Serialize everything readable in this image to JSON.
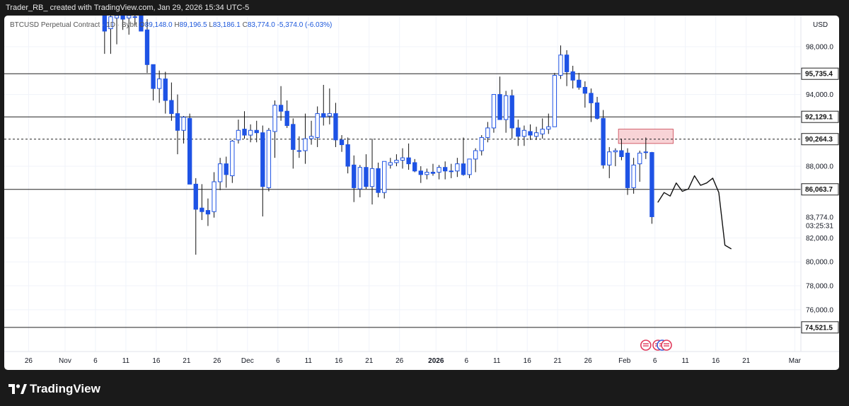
{
  "header": {
    "caption": "Trader_RB_ created with TradingView.com, Jan 29, 2026 15:34 UTC-5"
  },
  "symbol_bar": {
    "name": "BTCUSD Perpetual Contract",
    "interval": "1D",
    "exchange": "Bybit",
    "o_label": "O",
    "o_value": "89,148.0",
    "h_label": "H",
    "h_value": "89,196.5",
    "l_label": "L",
    "l_value": "83,186.1",
    "c_label": "C",
    "c_value": "83,774.0",
    "change": "-5,374.0 (-6.03%)"
  },
  "footer": {
    "brand": "TradingView"
  },
  "chart_data": {
    "type": "candlestick",
    "symbol": "BTCUSD Perpetual Contract",
    "interval": "1D",
    "exchange": "Bybit",
    "currency": "USD",
    "ylim": [
      72500,
      100600
    ],
    "y_ticks": [
      76000,
      78000,
      80000,
      82000,
      88000,
      94000,
      98000
    ],
    "y_tick_labels": [
      "76,000.0",
      "78,000.0",
      "80,000.0",
      "82,000.0",
      "88,000.0",
      "94,000.0",
      "98,000.0"
    ],
    "x_ticks": [
      {
        "label": "26",
        "date": "2025-10-26"
      },
      {
        "label": "Nov",
        "date": "2025-11-01"
      },
      {
        "label": "6",
        "date": "2025-11-06"
      },
      {
        "label": "11",
        "date": "2025-11-11"
      },
      {
        "label": "16",
        "date": "2025-11-16"
      },
      {
        "label": "21",
        "date": "2025-11-21"
      },
      {
        "label": "26",
        "date": "2025-11-26"
      },
      {
        "label": "Dec",
        "date": "2025-12-01"
      },
      {
        "label": "6",
        "date": "2025-12-06"
      },
      {
        "label": "11",
        "date": "2025-12-11"
      },
      {
        "label": "16",
        "date": "2025-12-16"
      },
      {
        "label": "21",
        "date": "2025-12-21"
      },
      {
        "label": "26",
        "date": "2025-12-26"
      },
      {
        "label": "2026",
        "date": "2026-01-01"
      },
      {
        "label": "6",
        "date": "2026-01-06"
      },
      {
        "label": "11",
        "date": "2026-01-11"
      },
      {
        "label": "16",
        "date": "2026-01-16"
      },
      {
        "label": "21",
        "date": "2026-01-21"
      },
      {
        "label": "26",
        "date": "2026-01-26"
      },
      {
        "label": "Feb",
        "date": "2026-02-01"
      },
      {
        "label": "6",
        "date": "2026-02-06"
      },
      {
        "label": "11",
        "date": "2026-02-11"
      },
      {
        "label": "16",
        "date": "2026-02-16"
      },
      {
        "label": "21",
        "date": "2026-02-21"
      },
      {
        "label": "Mar",
        "date": "2026-03-01"
      }
    ],
    "x_range": [
      "2025-10-22",
      "2026-03-02"
    ],
    "candles": [
      {
        "date": "2025-11-07",
        "o": 100900,
        "h": 101400,
        "l": 97400,
        "c": 99300
      },
      {
        "date": "2025-11-08",
        "o": 99500,
        "h": 101200,
        "l": 97400,
        "c": 100500
      },
      {
        "date": "2025-11-09",
        "o": 100400,
        "h": 101100,
        "l": 98200,
        "c": 100600
      },
      {
        "date": "2025-11-10",
        "o": 100600,
        "h": 101400,
        "l": 99400,
        "c": 100300
      },
      {
        "date": "2025-11-11",
        "o": 100400,
        "h": 100900,
        "l": 99000,
        "c": 100600
      },
      {
        "date": "2025-11-12",
        "o": 100500,
        "h": 101000,
        "l": 99800,
        "c": 100500
      },
      {
        "date": "2025-11-13",
        "o": 100600,
        "h": 101200,
        "l": 99600,
        "c": 99300
      },
      {
        "date": "2025-11-14",
        "o": 99400,
        "h": 100300,
        "l": 95800,
        "c": 96500
      },
      {
        "date": "2025-11-15",
        "o": 96500,
        "h": 96500,
        "l": 93500,
        "c": 94500
      },
      {
        "date": "2025-11-16",
        "o": 94500,
        "h": 96000,
        "l": 93300,
        "c": 95300
      },
      {
        "date": "2025-11-17",
        "o": 95300,
        "h": 95900,
        "l": 92400,
        "c": 93500
      },
      {
        "date": "2025-11-18",
        "o": 93500,
        "h": 95000,
        "l": 91800,
        "c": 92400
      },
      {
        "date": "2025-11-19",
        "o": 92400,
        "h": 94000,
        "l": 89000,
        "c": 91000
      },
      {
        "date": "2025-11-20",
        "o": 91000,
        "h": 92200,
        "l": 89900,
        "c": 92100
      },
      {
        "date": "2025-11-21",
        "o": 92000,
        "h": 92400,
        "l": 87600,
        "c": 86500
      },
      {
        "date": "2025-11-22",
        "o": 86500,
        "h": 87000,
        "l": 80600,
        "c": 84400
      },
      {
        "date": "2025-11-23",
        "o": 84500,
        "h": 86500,
        "l": 83500,
        "c": 84200
      },
      {
        "date": "2025-11-24",
        "o": 84300,
        "h": 85300,
        "l": 83000,
        "c": 84000
      },
      {
        "date": "2025-11-25",
        "o": 84200,
        "h": 87500,
        "l": 83700,
        "c": 86700
      },
      {
        "date": "2025-11-26",
        "o": 86700,
        "h": 88700,
        "l": 86000,
        "c": 88200
      },
      {
        "date": "2025-11-27",
        "o": 88200,
        "h": 88800,
        "l": 86200,
        "c": 87300
      },
      {
        "date": "2025-11-28",
        "o": 87200,
        "h": 90200,
        "l": 86600,
        "c": 90100
      },
      {
        "date": "2025-11-29",
        "o": 90200,
        "h": 91900,
        "l": 89900,
        "c": 91000
      },
      {
        "date": "2025-11-30",
        "o": 91100,
        "h": 92600,
        "l": 90300,
        "c": 90600
      },
      {
        "date": "2025-12-01",
        "o": 90600,
        "h": 91500,
        "l": 90000,
        "c": 91000
      },
      {
        "date": "2025-12-02",
        "o": 91000,
        "h": 91800,
        "l": 90000,
        "c": 90800
      },
      {
        "date": "2025-12-03",
        "o": 90800,
        "h": 91400,
        "l": 83800,
        "c": 86300
      },
      {
        "date": "2025-12-04",
        "o": 86200,
        "h": 91200,
        "l": 85900,
        "c": 91000
      },
      {
        "date": "2025-12-05",
        "o": 90900,
        "h": 93500,
        "l": 88700,
        "c": 93100
      },
      {
        "date": "2025-12-06",
        "o": 93100,
        "h": 94700,
        "l": 91800,
        "c": 92600
      },
      {
        "date": "2025-12-07",
        "o": 92600,
        "h": 93500,
        "l": 91200,
        "c": 91400
      },
      {
        "date": "2025-12-08",
        "o": 91500,
        "h": 92000,
        "l": 87800,
        "c": 89400
      },
      {
        "date": "2025-12-09",
        "o": 89300,
        "h": 90500,
        "l": 88700,
        "c": 89300
      },
      {
        "date": "2025-12-10",
        "o": 89300,
        "h": 92400,
        "l": 88200,
        "c": 90300
      },
      {
        "date": "2025-12-11",
        "o": 90300,
        "h": 91800,
        "l": 89800,
        "c": 90500
      },
      {
        "date": "2025-12-12",
        "o": 90400,
        "h": 93000,
        "l": 89600,
        "c": 92400
      },
      {
        "date": "2025-12-13",
        "o": 92400,
        "h": 94800,
        "l": 91400,
        "c": 92100
      },
      {
        "date": "2025-12-14",
        "o": 92200,
        "h": 94500,
        "l": 91500,
        "c": 92400
      },
      {
        "date": "2025-12-15",
        "o": 92400,
        "h": 93300,
        "l": 89600,
        "c": 90200
      },
      {
        "date": "2025-12-16",
        "o": 90200,
        "h": 90600,
        "l": 89200,
        "c": 89800
      },
      {
        "date": "2025-12-17",
        "o": 89800,
        "h": 90400,
        "l": 87400,
        "c": 88000
      },
      {
        "date": "2025-12-18",
        "o": 88100,
        "h": 88900,
        "l": 85000,
        "c": 86200
      },
      {
        "date": "2025-12-19",
        "o": 86100,
        "h": 88100,
        "l": 85400,
        "c": 87900
      },
      {
        "date": "2025-12-20",
        "o": 87900,
        "h": 89000,
        "l": 86100,
        "c": 86300
      },
      {
        "date": "2025-12-21",
        "o": 86300,
        "h": 90300,
        "l": 84800,
        "c": 87800
      },
      {
        "date": "2025-12-22",
        "o": 87800,
        "h": 88300,
        "l": 85400,
        "c": 85800
      },
      {
        "date": "2025-12-23",
        "o": 85800,
        "h": 88300,
        "l": 85300,
        "c": 88400
      },
      {
        "date": "2025-12-24",
        "o": 88100,
        "h": 88700,
        "l": 87800,
        "c": 88300
      },
      {
        "date": "2025-12-25",
        "o": 88300,
        "h": 89000,
        "l": 88000,
        "c": 88500
      },
      {
        "date": "2025-12-26",
        "o": 88500,
        "h": 89500,
        "l": 87800,
        "c": 88700
      },
      {
        "date": "2025-12-27",
        "o": 88700,
        "h": 89900,
        "l": 87700,
        "c": 88200
      },
      {
        "date": "2025-12-28",
        "o": 88300,
        "h": 88600,
        "l": 87500,
        "c": 87600
      },
      {
        "date": "2025-12-29",
        "o": 87600,
        "h": 88000,
        "l": 86600,
        "c": 87300
      },
      {
        "date": "2025-12-30",
        "o": 87300,
        "h": 87800,
        "l": 86900,
        "c": 87500
      },
      {
        "date": "2025-12-31",
        "o": 87500,
        "h": 88200,
        "l": 87200,
        "c": 87400
      },
      {
        "date": "2026-01-01",
        "o": 87500,
        "h": 88100,
        "l": 86900,
        "c": 87900
      },
      {
        "date": "2026-01-02",
        "o": 87900,
        "h": 88400,
        "l": 86900,
        "c": 87600
      },
      {
        "date": "2026-01-03",
        "o": 87600,
        "h": 88200,
        "l": 87000,
        "c": 87600
      },
      {
        "date": "2026-01-04",
        "o": 87600,
        "h": 88700,
        "l": 87100,
        "c": 88200
      },
      {
        "date": "2026-01-05",
        "o": 88200,
        "h": 90400,
        "l": 87200,
        "c": 87300
      },
      {
        "date": "2026-01-06",
        "o": 87300,
        "h": 88300,
        "l": 87000,
        "c": 88600
      },
      {
        "date": "2026-01-07",
        "o": 88600,
        "h": 89500,
        "l": 87500,
        "c": 89300
      },
      {
        "date": "2026-01-08",
        "o": 89300,
        "h": 90600,
        "l": 88900,
        "c": 90400
      },
      {
        "date": "2026-01-09",
        "o": 90400,
        "h": 91700,
        "l": 90000,
        "c": 91200
      },
      {
        "date": "2026-01-10",
        "o": 91200,
        "h": 93000,
        "l": 90800,
        "c": 94000
      },
      {
        "date": "2026-01-11",
        "o": 94000,
        "h": 95500,
        "l": 93400,
        "c": 91900
      },
      {
        "date": "2026-01-12",
        "o": 91900,
        "h": 94300,
        "l": 90800,
        "c": 93900
      },
      {
        "date": "2026-01-13",
        "o": 93900,
        "h": 94400,
        "l": 90300,
        "c": 91200
      },
      {
        "date": "2026-01-14",
        "o": 91200,
        "h": 91900,
        "l": 89700,
        "c": 90500
      },
      {
        "date": "2026-01-15",
        "o": 90500,
        "h": 91400,
        "l": 89700,
        "c": 91000
      },
      {
        "date": "2026-01-16",
        "o": 90900,
        "h": 91500,
        "l": 90200,
        "c": 90600
      },
      {
        "date": "2026-01-17",
        "o": 90500,
        "h": 91300,
        "l": 90200,
        "c": 90800
      },
      {
        "date": "2026-01-18",
        "o": 90700,
        "h": 92000,
        "l": 90300,
        "c": 91100
      },
      {
        "date": "2026-01-19",
        "o": 91100,
        "h": 92400,
        "l": 90700,
        "c": 91300
      },
      {
        "date": "2026-01-20",
        "o": 91300,
        "h": 95800,
        "l": 91300,
        "c": 95600
      },
      {
        "date": "2026-01-21",
        "o": 95600,
        "h": 98100,
        "l": 95300,
        "c": 97300
      },
      {
        "date": "2026-01-22",
        "o": 97300,
        "h": 97700,
        "l": 94700,
        "c": 95900
      },
      {
        "date": "2026-01-23",
        "o": 95900,
        "h": 96400,
        "l": 94500,
        "c": 95200
      },
      {
        "date": "2026-01-24",
        "o": 95200,
        "h": 95800,
        "l": 94400,
        "c": 94600
      },
      {
        "date": "2026-01-25",
        "o": 94600,
        "h": 95100,
        "l": 92900,
        "c": 94100
      },
      {
        "date": "2026-01-26",
        "o": 94100,
        "h": 94500,
        "l": 91700,
        "c": 93300
      },
      {
        "date": "2026-01-27",
        "o": 93300,
        "h": 93800,
        "l": 91900,
        "c": 92000
      },
      {
        "date": "2026-01-28",
        "o": 92000,
        "h": 92700,
        "l": 87800,
        "c": 88100
      },
      {
        "date": "2026-01-29",
        "o": 88100,
        "h": 89600,
        "l": 87000,
        "c": 89200
      },
      {
        "date": "2026-01-30",
        "o": 89200,
        "h": 89500,
        "l": 88000,
        "c": 89300
      },
      {
        "date": "2026-01-31",
        "o": 89300,
        "h": 90300,
        "l": 88500,
        "c": 88800
      },
      {
        "date": "2026-02-01",
        "o": 89100,
        "h": 89500,
        "l": 85600,
        "c": 86200
      },
      {
        "date": "2026-02-02",
        "o": 86200,
        "h": 88700,
        "l": 85700,
        "c": 88100
      },
      {
        "date": "2026-02-03",
        "o": 88200,
        "h": 89300,
        "l": 86700,
        "c": 89100
      },
      {
        "date": "2026-02-04",
        "o": 89148,
        "h": 90400,
        "l": 88600,
        "c": 89196
      },
      {
        "date": "2026-02-05",
        "o": 89148,
        "h": 89196.5,
        "l": 83186.1,
        "c": 83774
      }
    ],
    "levels": [
      {
        "value": 95735.4,
        "label": "95,735.4",
        "style": "solid"
      },
      {
        "value": 92129.1,
        "label": "92,129.1",
        "style": "solid"
      },
      {
        "value": 90264.3,
        "label": "90,264.3",
        "style": "dashed"
      },
      {
        "value": 86063.7,
        "label": "86,063.7",
        "style": "solid"
      },
      {
        "value": 74521.5,
        "label": "74,521.5",
        "style": "solid"
      }
    ],
    "supply_zone": {
      "from": "2026-01-31",
      "to": "2026-02-09",
      "low": 89900,
      "high": 91100,
      "color": "#f8d3d6"
    },
    "current_price": {
      "label": "83,774.0",
      "countdown": "03:25:31",
      "value": 83774
    },
    "projection_path": [
      {
        "date": "2026-02-06",
        "price": 85000
      },
      {
        "date": "2026-02-07",
        "price": 85800
      },
      {
        "date": "2026-02-08",
        "price": 85500
      },
      {
        "date": "2026-02-09",
        "price": 86600
      },
      {
        "date": "2026-02-10",
        "price": 85900
      },
      {
        "date": "2026-02-11",
        "price": 86100
      },
      {
        "date": "2026-02-12",
        "price": 87200
      },
      {
        "date": "2026-02-13",
        "price": 86400
      },
      {
        "date": "2026-02-14",
        "price": 86600
      },
      {
        "date": "2026-02-15",
        "price": 87000
      },
      {
        "date": "2026-02-16",
        "price": 85800
      },
      {
        "date": "2026-02-17",
        "price": 81400
      },
      {
        "date": "2026-02-18",
        "price": 81100
      }
    ],
    "colors": {
      "bull_body": "#ffffff",
      "bull_border": "#1e53e5",
      "bear_body": "#1e53e5",
      "bear_border": "#1e53e5",
      "wick": "#111111",
      "level": "#222222",
      "grid": "#f0f3fa",
      "event_red": "#e0395a",
      "event_blue": "#3b5bdb"
    }
  }
}
